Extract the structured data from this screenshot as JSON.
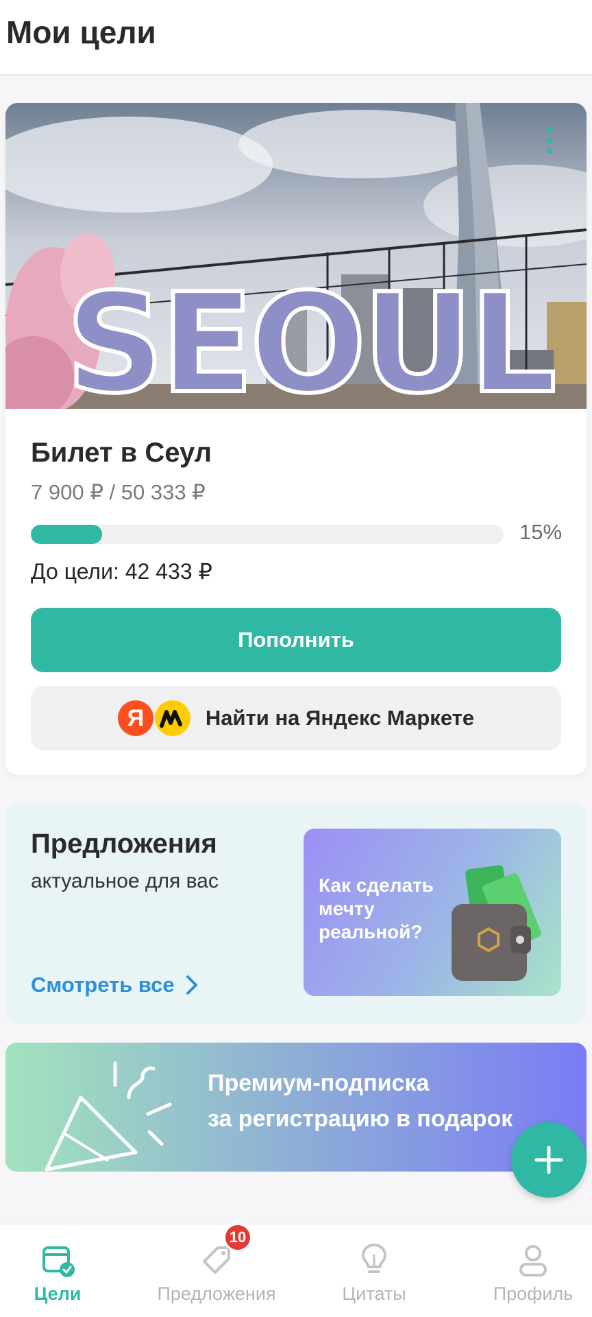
{
  "header": {
    "title": "Мои цели"
  },
  "goal": {
    "image_caption": "SEOUL",
    "title": "Билет в Сеул",
    "amount": "7 900 ₽ / 50 333 ₽",
    "progress_fraction": 0.15,
    "progress_label": "15%",
    "remaining": "До цели: 42 433 ₽",
    "topup_label": "Пополнить",
    "market_label": "Найти на Яндекс Маркете",
    "ya_letter": "Я"
  },
  "offers": {
    "title": "Предложения",
    "subtitle": "актуальное для вас",
    "link": "Смотреть все",
    "promo_text": "Как сделать мечту реальной?"
  },
  "premium": {
    "line1": "Премиум-подписка",
    "line2": "за регистрацию в подарок"
  },
  "nav": {
    "items": [
      {
        "label": "Цели",
        "icon": "goals-icon",
        "active": true
      },
      {
        "label": "Предложения",
        "icon": "tag-icon",
        "badge": "10"
      },
      {
        "label": "Цитаты",
        "icon": "lightbulb-icon"
      },
      {
        "label": "Профиль",
        "icon": "profile-icon"
      }
    ]
  },
  "colors": {
    "accent": "#2fb8a4",
    "link": "#2f8fd8",
    "badge": "#e53935"
  }
}
